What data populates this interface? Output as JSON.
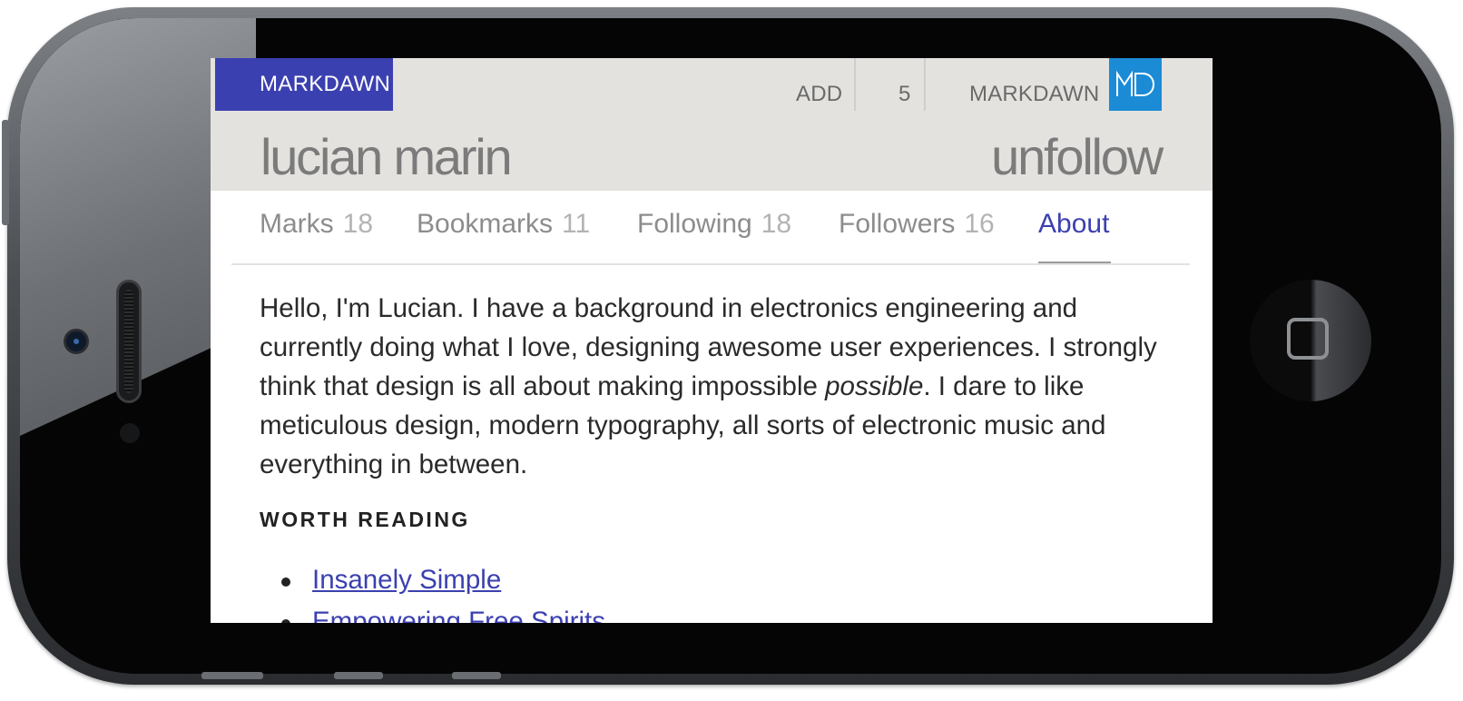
{
  "header": {
    "brand": "MARKDAWN",
    "nav_add": "ADD",
    "nav_count": "5",
    "nav_user": "MARKDAWN",
    "logo_icon": "markdawn-md-logo"
  },
  "profile": {
    "name": "lucian marin",
    "action": "unfollow"
  },
  "tabs": [
    {
      "label": "Marks",
      "count": "18"
    },
    {
      "label": "Bookmarks",
      "count": "11"
    },
    {
      "label": "Following",
      "count": "18"
    },
    {
      "label": "Followers",
      "count": "16"
    },
    {
      "label": "About",
      "active": true
    }
  ],
  "about": {
    "bio_before": "Hello, I'm Lucian. I have a background in electronics engineering and currently doing what I love, designing awesome user experiences. I strongly think that design is all about making impossible ",
    "bio_emphasis": "possible",
    "bio_after": ". I dare to like meticulous design, modern typography, all sorts of electronic music and everything in between.",
    "section_title": "WORTH READING",
    "links": [
      "Insanely Simple",
      "Empowering Free Spirits"
    ]
  },
  "colors": {
    "accent": "#3b40b0",
    "logo_blue": "#1b8bd6",
    "header_bg": "#e3e2de"
  }
}
